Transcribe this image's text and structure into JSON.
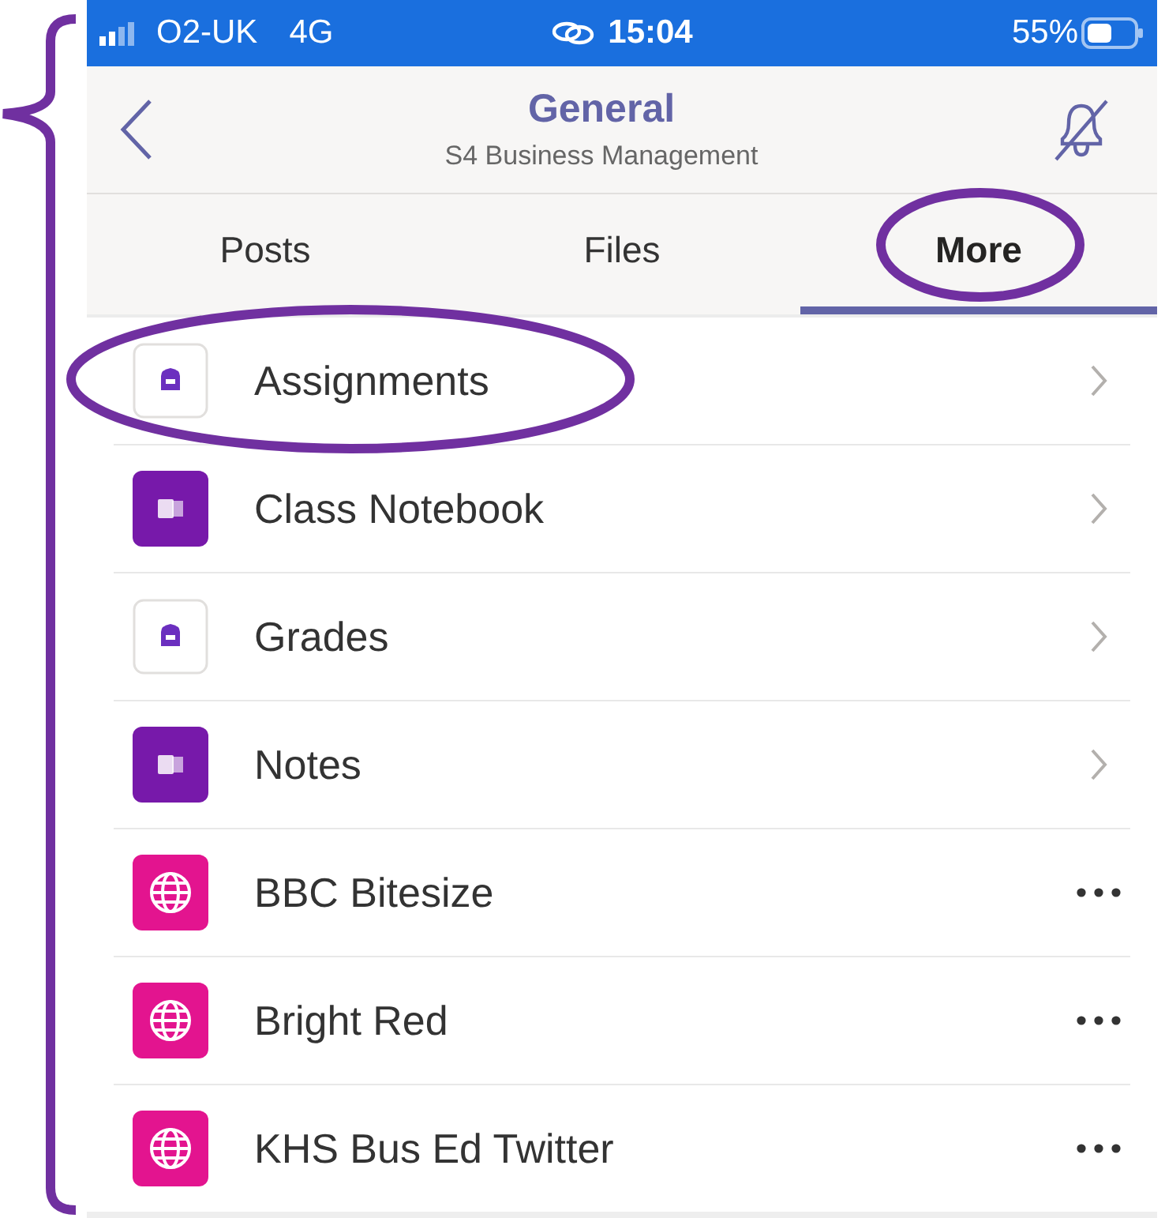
{
  "status_bar": {
    "carrier": "O2-UK",
    "network": "4G",
    "time": "15:04",
    "battery": "55%"
  },
  "header": {
    "title": "General",
    "subtitle": "S4 Business Management"
  },
  "tabs": [
    {
      "label": "Posts",
      "selected": false,
      "circled": false
    },
    {
      "label": "Files",
      "selected": false,
      "circled": false
    },
    {
      "label": "More",
      "selected": true,
      "circled": true
    }
  ],
  "items": [
    {
      "label": "Assignments",
      "kind": "assignments",
      "circled": true
    },
    {
      "label": "Class Notebook",
      "kind": "notebook",
      "circled": false
    },
    {
      "label": "Grades",
      "kind": "assignments",
      "circled": false
    },
    {
      "label": "Notes",
      "kind": "notebook",
      "circled": false
    },
    {
      "label": "BBC Bitesize",
      "kind": "web",
      "circled": false
    },
    {
      "label": "Bright Red",
      "kind": "web",
      "circled": false
    },
    {
      "label": "KHS Bus Ed Twitter",
      "kind": "web",
      "circled": false
    }
  ]
}
